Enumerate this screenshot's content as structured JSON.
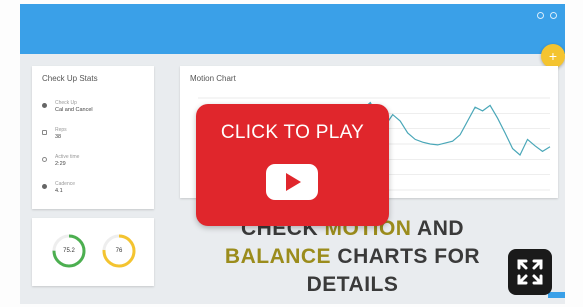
{
  "stats_card": {
    "title": "Check Up Stats",
    "items": [
      {
        "icon": "dot-icon",
        "label": "Check Up",
        "value": "Cal and Cancel"
      },
      {
        "icon": "square-icon",
        "label": "Reps",
        "value": "38"
      },
      {
        "icon": "clock-icon",
        "label": "Active time",
        "value": "2:29"
      },
      {
        "icon": "dot-icon",
        "label": "Cadence",
        "value": "4.1"
      }
    ]
  },
  "gauges": [
    {
      "label": "75.2",
      "value": 0.752,
      "color": "#4caf50"
    },
    {
      "label": "76",
      "value": 0.76,
      "color": "#f4c430"
    }
  ],
  "motion_card": {
    "title": "Motion Chart"
  },
  "chart_data": {
    "type": "line",
    "title": "Motion Chart",
    "xlabel": "",
    "ylabel": "",
    "series": [
      {
        "color": "#4aa7b8",
        "values": [
          0.5,
          0.48,
          0.51,
          0.49,
          0.5,
          0.47,
          0.52,
          0.49,
          0.5,
          0.48,
          0.51,
          0.5,
          0.49,
          0.52,
          0.48,
          0.5,
          0.51,
          0.49,
          0.55,
          0.62,
          0.78,
          0.92,
          0.88,
          0.95,
          0.8,
          0.7,
          0.82,
          0.75,
          0.62,
          0.55,
          0.52,
          0.5,
          0.49,
          0.51,
          0.53,
          0.6,
          0.75,
          0.9,
          0.86,
          0.92,
          0.78,
          0.62,
          0.45,
          0.38,
          0.55,
          0.48,
          0.42,
          0.47
        ]
      }
    ],
    "grid": true
  },
  "play_overlay": {
    "label": "CLICK TO PLAY"
  },
  "headline": {
    "part1": "CHECK ",
    "highlight1": "MOTION",
    "part2": " AND",
    "highlight2": "BALANCE",
    "part3": " CHARTS FOR",
    "line3": "DETAILS"
  },
  "colors": {
    "topbar": "#3aa0e8",
    "play": "#e0262c",
    "accent": "#f4c430",
    "highlight": "#9b8c1c"
  }
}
